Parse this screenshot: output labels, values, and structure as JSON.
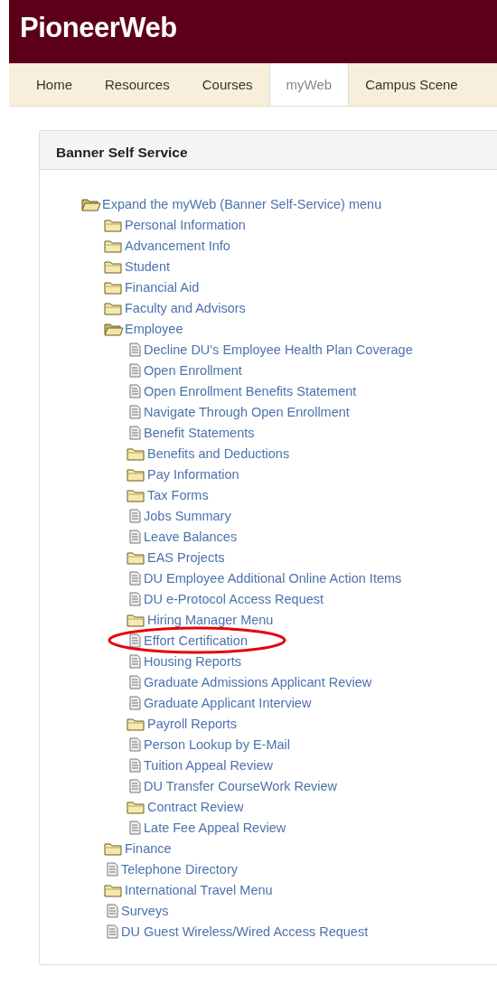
{
  "site": {
    "title": "PioneerWeb"
  },
  "tabs": [
    {
      "label": "Home",
      "selected": false
    },
    {
      "label": "Resources",
      "selected": false
    },
    {
      "label": "Courses",
      "selected": false
    },
    {
      "label": "myWeb",
      "selected": true
    },
    {
      "label": "Campus Scene",
      "selected": false
    }
  ],
  "panel": {
    "title": "Banner Self Service"
  },
  "tree": [
    {
      "label": "Expand the myWeb (Banner Self-Service) menu",
      "kind": "folder",
      "expanded": true,
      "circled": false,
      "children": [
        {
          "label": "Personal Information",
          "kind": "folder",
          "expanded": false,
          "circled": false
        },
        {
          "label": "Advancement Info",
          "kind": "folder",
          "expanded": false,
          "circled": false
        },
        {
          "label": "Student",
          "kind": "folder",
          "expanded": false,
          "circled": false
        },
        {
          "label": "Financial Aid",
          "kind": "folder",
          "expanded": false,
          "circled": false
        },
        {
          "label": "Faculty and Advisors",
          "kind": "folder",
          "expanded": false,
          "circled": false
        },
        {
          "label": "Employee",
          "kind": "folder",
          "expanded": true,
          "circled": false,
          "children": [
            {
              "label": "Decline DU's Employee Health Plan Coverage",
              "kind": "page",
              "circled": false
            },
            {
              "label": "Open Enrollment",
              "kind": "page",
              "circled": false
            },
            {
              "label": "Open Enrollment Benefits Statement",
              "kind": "page",
              "circled": false
            },
            {
              "label": "Navigate Through Open Enrollment",
              "kind": "page",
              "circled": false
            },
            {
              "label": "Benefit Statements",
              "kind": "page",
              "circled": false
            },
            {
              "label": "Benefits and Deductions",
              "kind": "folder",
              "expanded": false,
              "circled": false
            },
            {
              "label": "Pay Information",
              "kind": "folder",
              "expanded": false,
              "circled": false
            },
            {
              "label": "Tax Forms",
              "kind": "folder",
              "expanded": false,
              "circled": false
            },
            {
              "label": "Jobs Summary",
              "kind": "page",
              "circled": false
            },
            {
              "label": "Leave Balances",
              "kind": "page",
              "circled": false
            },
            {
              "label": "EAS Projects",
              "kind": "folder",
              "expanded": false,
              "circled": false
            },
            {
              "label": "DU Employee Additional Online Action Items",
              "kind": "page",
              "circled": false
            },
            {
              "label": "DU e-Protocol Access Request",
              "kind": "page",
              "circled": false
            },
            {
              "label": "Hiring Manager Menu",
              "kind": "folder",
              "expanded": false,
              "circled": false
            },
            {
              "label": "Effort Certification",
              "kind": "page",
              "circled": true
            },
            {
              "label": "Housing Reports",
              "kind": "page",
              "circled": false
            },
            {
              "label": "Graduate Admissions Applicant Review",
              "kind": "page",
              "circled": false
            },
            {
              "label": "Graduate Applicant Interview",
              "kind": "page",
              "circled": false
            },
            {
              "label": "Payroll Reports",
              "kind": "folder",
              "expanded": false,
              "circled": false
            },
            {
              "label": "Person Lookup by E-Mail",
              "kind": "page",
              "circled": false
            },
            {
              "label": "Tuition Appeal Review",
              "kind": "page",
              "circled": false
            },
            {
              "label": "DU Transfer CourseWork Review",
              "kind": "page",
              "circled": false
            },
            {
              "label": "Contract Review",
              "kind": "folder",
              "expanded": false,
              "circled": false
            },
            {
              "label": "Late Fee Appeal Review",
              "kind": "page",
              "circled": false
            }
          ]
        },
        {
          "label": "Finance",
          "kind": "folder",
          "expanded": false,
          "circled": false
        },
        {
          "label": "Telephone Directory",
          "kind": "page",
          "circled": false
        },
        {
          "label": "International Travel Menu",
          "kind": "folder",
          "expanded": false,
          "circled": false
        },
        {
          "label": "Surveys",
          "kind": "page",
          "circled": false
        },
        {
          "label": "DU Guest Wireless/Wired Access Request",
          "kind": "page",
          "circled": false
        }
      ]
    }
  ]
}
